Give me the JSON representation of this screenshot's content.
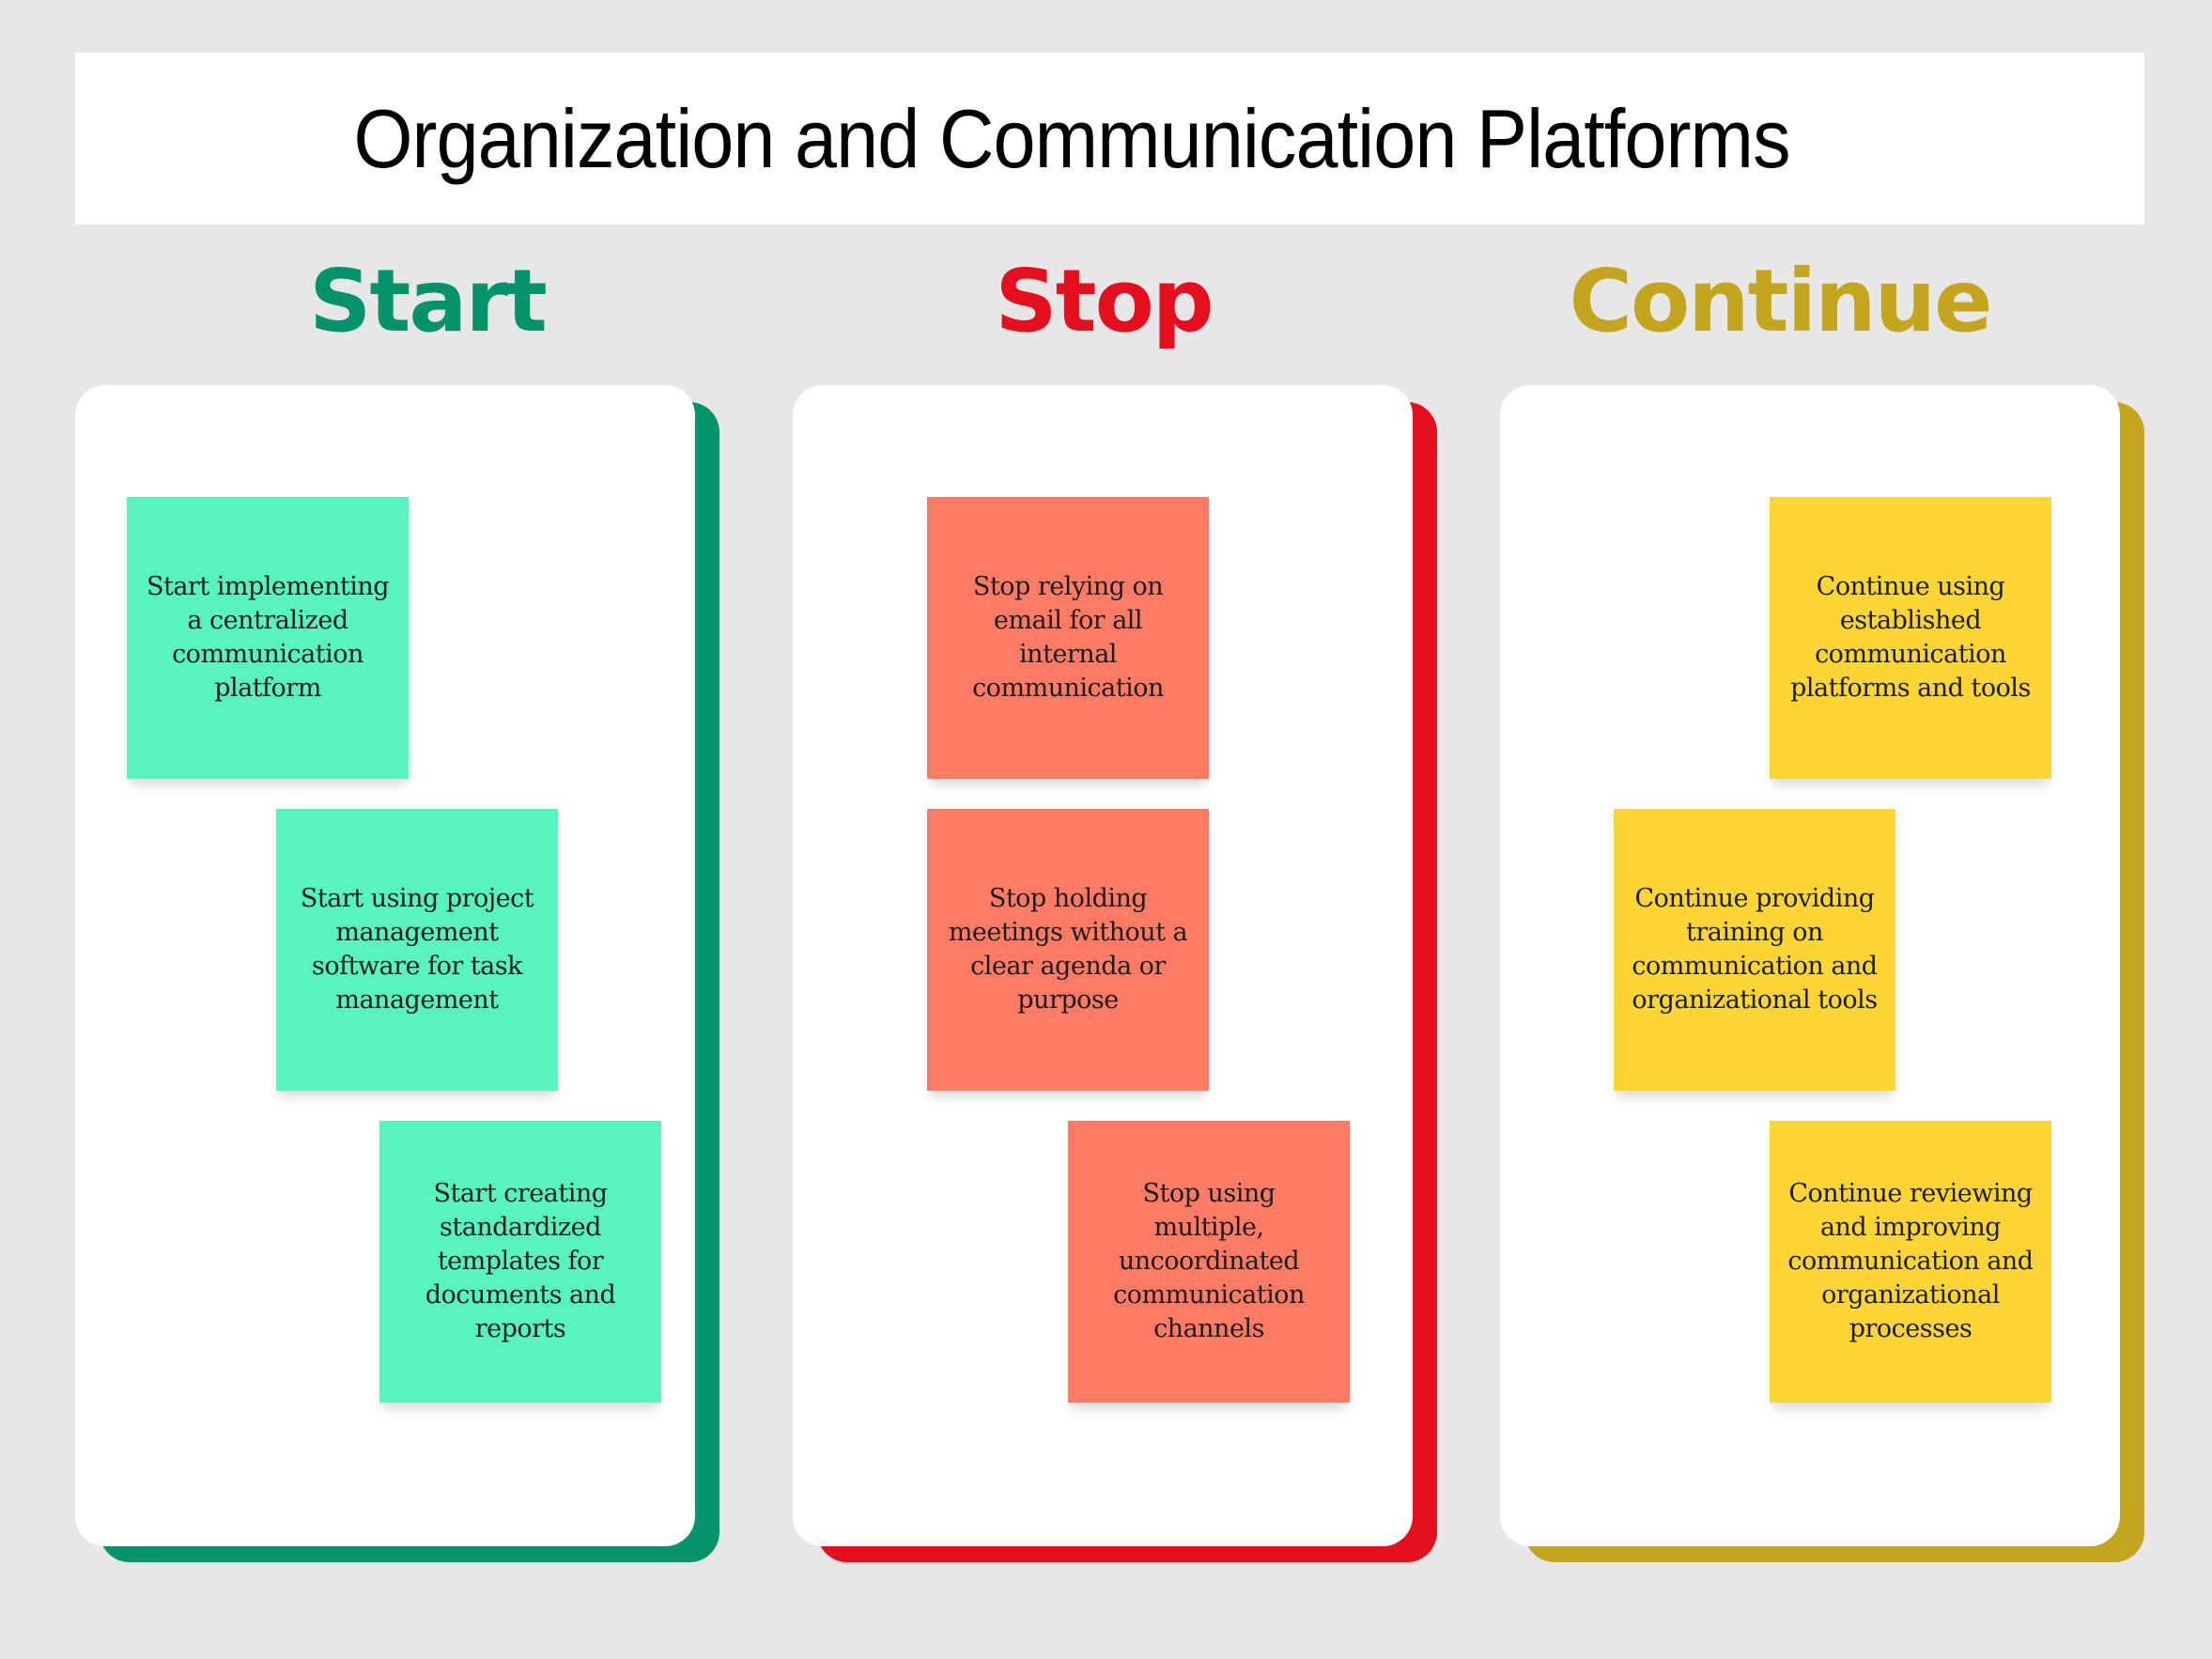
{
  "title": "Organization and Communication Platforms",
  "colors": {
    "background": "#e7e7e7",
    "start": "#03936a",
    "stop": "#e50e1e",
    "continue": "#c5a41e",
    "start_note": "#57f5bd",
    "stop_note": "#ff7b65",
    "continue_note": "#fdd535"
  },
  "columns": [
    {
      "heading": "Start",
      "notes": [
        "Start implementing a centralized communication platform",
        "Start using project management software for task management",
        "Start creating standardized templates for documents and reports"
      ]
    },
    {
      "heading": "Stop",
      "notes": [
        "Stop relying on email for all internal communication",
        "Stop holding meetings without a clear agenda or purpose",
        "Stop using multiple, uncoordinated communication channels"
      ]
    },
    {
      "heading": "Continue",
      "notes": [
        "Continue using established communication platforms and tools",
        "Continue providing training on communication and organizational tools",
        "Continue reviewing and improving communication and organizational processes"
      ]
    }
  ]
}
